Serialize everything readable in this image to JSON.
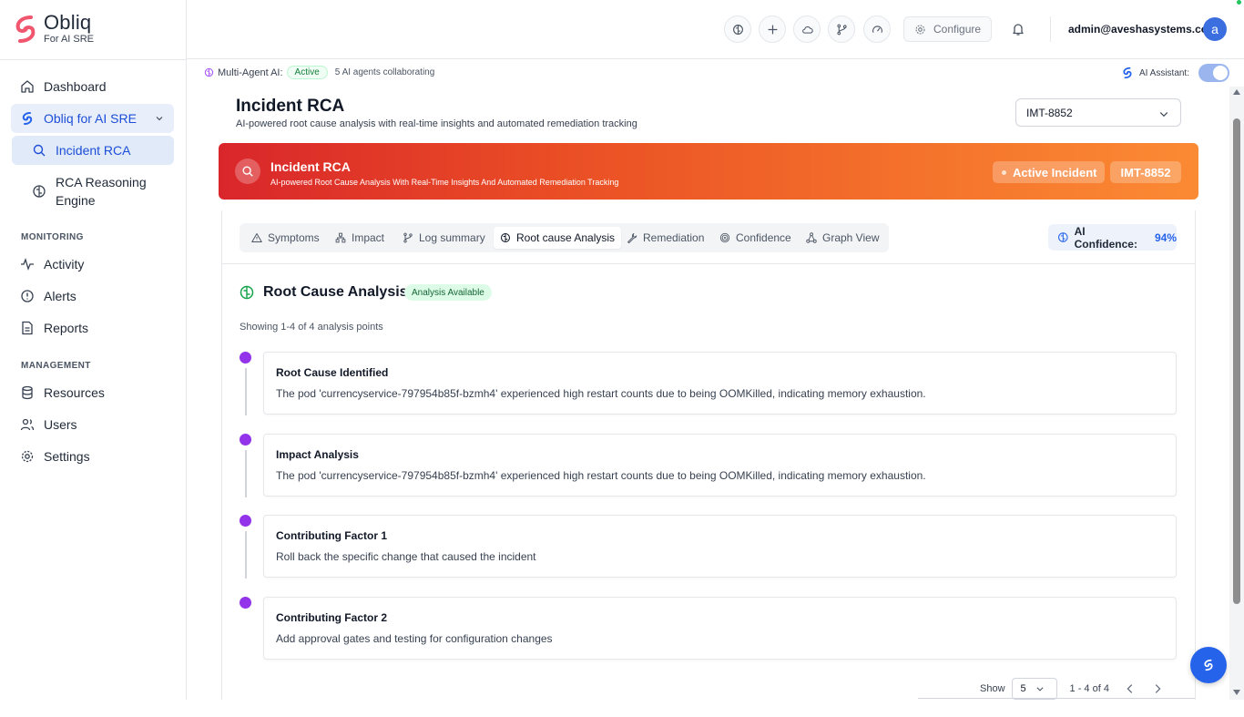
{
  "brand": {
    "name": "Obliq",
    "tagline": "For AI SRE",
    "accent": "#f0566e"
  },
  "sidebar": {
    "items": [
      {
        "label": "Dashboard",
        "icon": "home-icon"
      },
      {
        "label": "Obliq for AI SRE",
        "icon": "obliq-logo-icon"
      },
      {
        "label": "Incident RCA",
        "icon": "search-icon"
      },
      {
        "label": "RCA Reasoning Engine",
        "icon": "brain-icon"
      }
    ],
    "monitoring_label": "MONITORING",
    "monitoring": [
      {
        "label": "Activity",
        "icon": "activity-icon"
      },
      {
        "label": "Alerts",
        "icon": "alert-circle-icon"
      },
      {
        "label": "Reports",
        "icon": "file-text-icon"
      }
    ],
    "management_label": "MANAGEMENT",
    "management": [
      {
        "label": "Resources",
        "icon": "database-icon"
      },
      {
        "label": "Users",
        "icon": "users-icon"
      },
      {
        "label": "Settings",
        "icon": "gear-icon"
      }
    ]
  },
  "topbar": {
    "configure_label": "Configure",
    "user_email": "admin@aveshasystems.com",
    "avatar_initial": "a"
  },
  "agent_strip": {
    "label": "Multi-Agent AI:",
    "status": "Active",
    "count_text": "5 AI agents collaborating",
    "assistant_label": "AI Assistant:",
    "assistant_on": true
  },
  "page": {
    "title": "Incident RCA",
    "subtitle": "AI-powered root cause analysis with real-time insights and automated remediation tracking",
    "selected_incident": "IMT-8852"
  },
  "banner": {
    "title": "Incident RCA",
    "subtitle": "AI-powered Root Cause Analysis With Real-Time Insights And Automated Remediation Tracking",
    "status": "Active Incident",
    "incident_id": "IMT-8852"
  },
  "tabs": [
    {
      "label": "Symptoms",
      "icon": "warning-triangle-icon"
    },
    {
      "label": "Impact",
      "icon": "network-icon"
    },
    {
      "label": "Log summary",
      "icon": "git-branch-icon"
    },
    {
      "label": "Root cause Analysis",
      "icon": "brain-icon"
    },
    {
      "label": "Remediation",
      "icon": "wrench-icon"
    },
    {
      "label": "Confidence",
      "icon": "target-icon"
    },
    {
      "label": "Graph View",
      "icon": "graph-icon"
    }
  ],
  "active_tab": "Root cause Analysis",
  "confidence": {
    "label": "AI Confidence:",
    "value": "94%"
  },
  "rca": {
    "title": "Root Cause Analysis",
    "badge": "Analysis Available",
    "showing": "Showing 1-4 of 4 analysis points",
    "points": [
      {
        "title": "Root Cause Identified",
        "text": "The pod 'currencyservice-797954b85f-bzmh4' experienced high restart counts due to being OOMKilled, indicating memory exhaustion."
      },
      {
        "title": "Impact Analysis",
        "text": "The pod 'currencyservice-797954b85f-bzmh4' experienced high restart counts due to being OOMKilled, indicating memory exhaustion."
      },
      {
        "title": "Contributing Factor 1",
        "text": "Roll back the specific change that caused the incident"
      },
      {
        "title": "Contributing Factor 2",
        "text": "Add approval gates and testing for configuration changes"
      }
    ]
  },
  "pagination": {
    "show_label": "Show",
    "page_size": "5",
    "range": "1 - 4 of 4"
  },
  "colors": {
    "banner_start": "#d9262b",
    "banner_end": "#fb8a34",
    "timeline_dot": "#9333ea",
    "primary": "#2563eb"
  }
}
